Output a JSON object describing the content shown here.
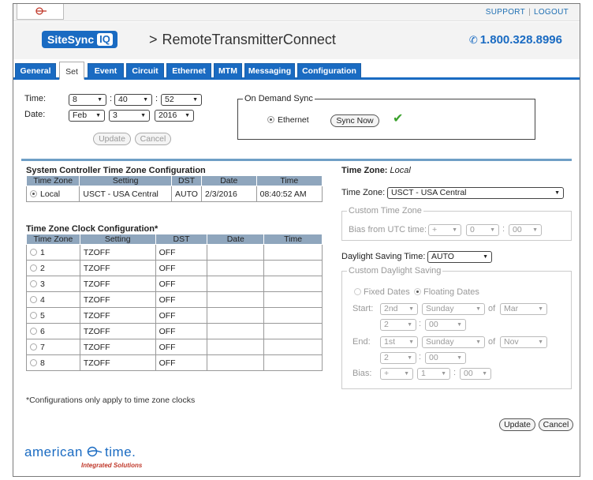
{
  "top_links": {
    "support": "SUPPORT",
    "separator": "|",
    "logout": "LOGOUT"
  },
  "header": {
    "logo_text": "SiteSync",
    "logo_badge": "IQ",
    "breadcrumb_sep": ">",
    "app_title": "RemoteTransmitterConnect",
    "phone": "1.800.328.8996"
  },
  "tabs": [
    {
      "label": "General"
    },
    {
      "label": "Set",
      "active": true
    },
    {
      "label": "Event"
    },
    {
      "label": "Circuit"
    },
    {
      "label": "Ethernet"
    },
    {
      "label": "MTM"
    },
    {
      "label": "Messaging"
    },
    {
      "label": "Configuration"
    }
  ],
  "time_form": {
    "time_label": "Time:",
    "date_label": "Date:",
    "hour": "8",
    "minute": "40",
    "second": "52",
    "month": "Feb",
    "day": "3",
    "year": "2016",
    "colon": ":",
    "update": "Update",
    "cancel": "Cancel"
  },
  "on_demand": {
    "legend": "On Demand Sync",
    "option": "Ethernet",
    "sync_now": "Sync Now"
  },
  "sys_tz": {
    "title": "System Controller Time Zone Configuration",
    "headers": [
      "Time Zone",
      "Setting",
      "DST",
      "Date",
      "Time"
    ],
    "row": {
      "zone": "Local",
      "setting": "USCT - USA Central",
      "dst": "AUTO",
      "date": "2/3/2016",
      "time": "08:40:52 AM"
    }
  },
  "clock_tz": {
    "title": "Time Zone Clock Configuration*",
    "headers": [
      "Time Zone",
      "Setting",
      "DST",
      "Date",
      "Time"
    ],
    "rows": [
      {
        "zone": "1",
        "setting": "TZOFF",
        "dst": "OFF",
        "date": "",
        "time": ""
      },
      {
        "zone": "2",
        "setting": "TZOFF",
        "dst": "OFF",
        "date": "",
        "time": ""
      },
      {
        "zone": "3",
        "setting": "TZOFF",
        "dst": "OFF",
        "date": "",
        "time": ""
      },
      {
        "zone": "4",
        "setting": "TZOFF",
        "dst": "OFF",
        "date": "",
        "time": ""
      },
      {
        "zone": "5",
        "setting": "TZOFF",
        "dst": "OFF",
        "date": "",
        "time": ""
      },
      {
        "zone": "6",
        "setting": "TZOFF",
        "dst": "OFF",
        "date": "",
        "time": ""
      },
      {
        "zone": "7",
        "setting": "TZOFF",
        "dst": "OFF",
        "date": "",
        "time": ""
      },
      {
        "zone": "8",
        "setting": "TZOFF",
        "dst": "OFF",
        "date": "",
        "time": ""
      }
    ],
    "note": "*Configurations only apply to time zone clocks"
  },
  "tz_panel": {
    "heading_label": "Time Zone:",
    "heading_value": "Local",
    "tz_label": "Time Zone:",
    "tz_value": "USCT - USA Central",
    "custom_tz_legend": "Custom Time Zone",
    "bias_label": "Bias from UTC time:",
    "bias_sign": "+",
    "bias_hour": "0",
    "bias_min": "00",
    "dst_label": "Daylight Saving Time:",
    "dst_value": "AUTO",
    "custom_dst_legend": "Custom Daylight Saving",
    "fixed_dates": "Fixed Dates",
    "floating_dates": "Floating Dates",
    "start_label": "Start:",
    "start_week": "2nd",
    "start_day": "Sunday",
    "of": "of",
    "start_month": "Mar",
    "start_hour": "2",
    "start_min": "00",
    "end_label": "End:",
    "end_week": "1st",
    "end_day": "Sunday",
    "end_month": "Nov",
    "end_hour": "2",
    "end_min": "00",
    "bias2_label": "Bias:",
    "bias2_sign": "+",
    "bias2_hour": "1",
    "bias2_min": "00",
    "update": "Update",
    "cancel": "Cancel"
  },
  "brand": {
    "name": "american",
    "name2": "time.",
    "tagline": "Integrated Solutions"
  },
  "colors": {
    "accent": "#1a6bc2",
    "table_header": "#8fa6bd",
    "divider": "#6f9fc6",
    "check": "#3aa12c"
  }
}
